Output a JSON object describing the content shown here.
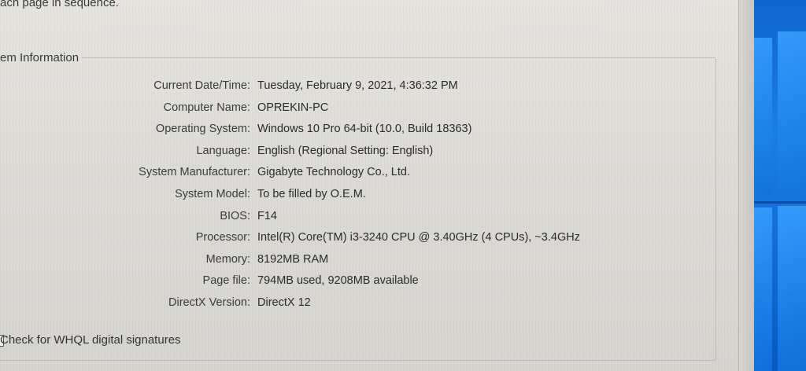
{
  "intro_text": "ach page in sequence.",
  "group": {
    "title": "em Information"
  },
  "system_info": [
    {
      "label": "Current Date/Time:",
      "value": "Tuesday, February 9, 2021, 4:36:32 PM"
    },
    {
      "label": "Computer Name:",
      "value": "OPREKIN-PC"
    },
    {
      "label": "Operating System:",
      "value": "Windows 10 Pro 64-bit (10.0, Build 18363)"
    },
    {
      "label": "Language:",
      "value": "English (Regional Setting: English)"
    },
    {
      "label": "System Manufacturer:",
      "value": "Gigabyte Technology Co., Ltd."
    },
    {
      "label": "System Model:",
      "value": "To be filled by O.E.M."
    },
    {
      "label": "BIOS:",
      "value": "F14"
    },
    {
      "label": "Processor:",
      "value": "Intel(R) Core(TM) i3-3240 CPU @ 3.40GHz (4 CPUs), ~3.4GHz"
    },
    {
      "label": "Memory:",
      "value": "8192MB RAM"
    },
    {
      "label": "Page file:",
      "value": "794MB used, 9208MB available"
    },
    {
      "label": "DirectX Version:",
      "value": "DirectX 12"
    }
  ],
  "whql_checkbox": {
    "label": "Check for WHQL digital signatures",
    "checked": false
  },
  "colors": {
    "dialog_bg": "#dddbd6",
    "desktop_blue": "#1a7ee6"
  }
}
